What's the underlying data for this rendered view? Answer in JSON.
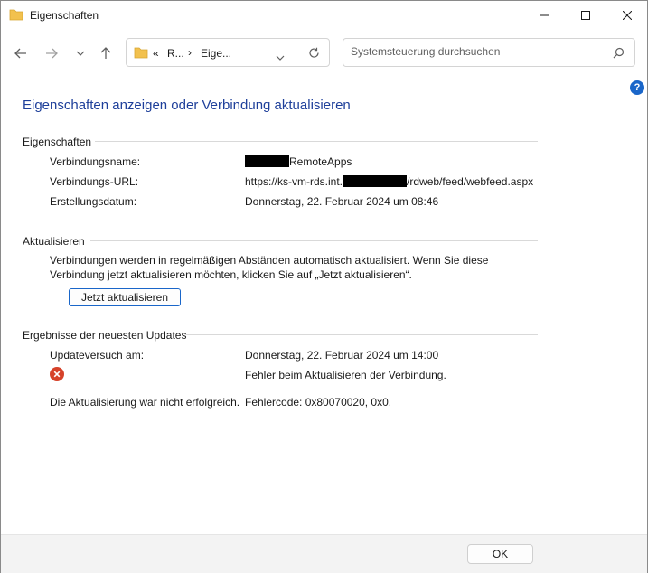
{
  "window": {
    "title": "Eigenschaften",
    "accent": "#1e3f9a"
  },
  "nav": {
    "breadcrumb": [
      "«",
      "R...",
      "›",
      "Eige..."
    ],
    "search_placeholder": "Systemsteuerung durchsuchen"
  },
  "page": {
    "heading": "Eigenschaften anzeigen oder Verbindung aktualisieren"
  },
  "properties": {
    "section_title": "Eigenschaften",
    "connection_name_label": "Verbindungsname:",
    "connection_name_value": "RemoteApps",
    "connection_url_label": "Verbindungs-URL:",
    "connection_url_prefix": "https://ks-vm-rds.int.",
    "connection_url_suffix": "/rdweb/feed/webfeed.aspx",
    "created_label": "Erstellungsdatum:",
    "created_value": "Donnerstag, 22. Februar 2024 um 08:46"
  },
  "update": {
    "section_title": "Aktualisieren",
    "description": "Verbindungen werden in regelmäßigen Abständen automatisch aktualisiert. Wenn Sie diese Verbindung jetzt aktualisieren möchten, klicken Sie auf „Jetzt aktualisieren“.",
    "button_label": "Jetzt aktualisieren"
  },
  "results": {
    "section_title": "Ergebnisse der neuesten Updates",
    "attempt_label": "Updateversuch am:",
    "attempt_value": "Donnerstag, 22. Februar 2024 um 14:00",
    "error_message": "Fehler beim Aktualisieren der Verbindung.",
    "failure_label": "Die Aktualisierung war nicht erfolgreich.",
    "failure_code": "Fehlercode: 0x80070020, 0x0."
  },
  "footer": {
    "ok_label": "OK"
  },
  "help": {
    "label": "?"
  }
}
